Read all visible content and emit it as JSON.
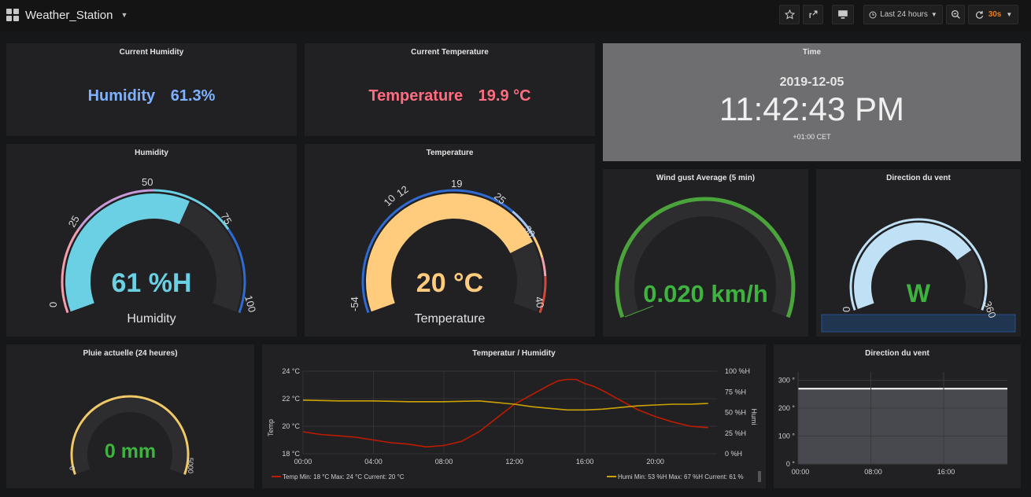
{
  "topbar": {
    "dashboard_title": "Weather_Station",
    "time_range": "Last 24 hours",
    "refresh": "30s"
  },
  "panels": {
    "current_humidity": {
      "title": "Current Humidity",
      "label": "Humidity",
      "value": "61.3%",
      "color": "#7eb2ff"
    },
    "current_temperature": {
      "title": "Current Temperature",
      "label": "Temperature",
      "value": "19.9 °C",
      "color": "#ff6d80"
    },
    "time": {
      "title": "Time",
      "date": "2019-12-05",
      "clock": "11:42:43 PM",
      "tz": "+01:00 CET"
    },
    "humidity_gauge": {
      "title": "Humidity",
      "value_text": "61 %H",
      "sub_label": "Humidity",
      "value": 61,
      "min": 0,
      "max": 100,
      "ticks": [
        "0",
        "25",
        "50",
        "75",
        "100"
      ],
      "fill_color": "#6bd0e3"
    },
    "temperature_gauge": {
      "title": "Temperature",
      "value_text": "20 °C",
      "sub_label": "Temperature",
      "value": 20,
      "min": -54,
      "max": 40,
      "ticks": [
        "-54",
        "10",
        "12",
        "19",
        "25",
        "30",
        "40"
      ],
      "fill_color": "#ffcb7d"
    },
    "wind_gust": {
      "title": "Wind gust Average (5 min)",
      "value_text": "0.020 km/h",
      "value": 0.02,
      "color": "#4ba43b"
    },
    "wind_direction_gauge": {
      "title": "Direction du vent",
      "value_text": "W",
      "tick": "360",
      "color": "#bfe0f5",
      "value_color": "#3fb33f"
    },
    "rain": {
      "title": "Pluie actuelle (24 heures)",
      "value_text": "0 mm",
      "value": 0,
      "tick_min": "0",
      "tick_max": "5000",
      "color": "#f0c868",
      "value_color": "#3fb33f"
    },
    "temp_humidity_chart": {
      "title": "Temperatur / Humidity",
      "legend_temp": "Temp  Min: 18 °C  Max: 24 °C  Current: 20 °C",
      "legend_humi": "Humi  Min: 53 %H  Max: 67 %H  Current: 61 %",
      "left_axis_title": "Temp",
      "right_axis_title": "Humi"
    },
    "wind_direction_chart": {
      "title": "Direction du vent"
    }
  },
  "chart_data": [
    {
      "type": "line",
      "title": "Temperatur / Humidity",
      "xlabel": "",
      "x_ticks": [
        "00:00",
        "04:00",
        "08:00",
        "12:00",
        "16:00",
        "20:00"
      ],
      "y_left_ticks": [
        "18 °C",
        "20 °C",
        "22 °C",
        "24 °C"
      ],
      "y_right_ticks": [
        "0 %H",
        "25 %H",
        "50 %H",
        "75 %H",
        "100 %H"
      ],
      "ylim_left": [
        18,
        24
      ],
      "ylim_right": [
        0,
        100
      ],
      "series": [
        {
          "name": "Temp",
          "axis": "left",
          "color": "#bf1b00",
          "x": [
            0,
            1,
            2,
            3,
            4,
            5,
            6,
            7,
            8,
            9,
            10,
            11,
            12,
            13,
            14,
            14.5,
            15,
            15.5,
            16,
            16.5,
            17,
            18,
            19,
            20,
            21,
            22,
            23
          ],
          "y": [
            19.6,
            19.4,
            19.3,
            19.2,
            19.0,
            18.8,
            18.7,
            18.5,
            18.6,
            18.9,
            19.6,
            20.6,
            21.6,
            22.3,
            23.0,
            23.3,
            23.4,
            23.4,
            23.1,
            22.9,
            22.6,
            21.9,
            21.2,
            20.7,
            20.3,
            20.0,
            19.9
          ]
        },
        {
          "name": "Humi",
          "axis": "right",
          "color": "#cca300",
          "x": [
            0,
            2,
            4,
            6,
            8,
            10,
            12,
            13,
            14,
            15,
            16,
            17,
            18,
            19,
            20,
            21,
            22,
            23
          ],
          "y": [
            65,
            64,
            64,
            63,
            63,
            64,
            60,
            57,
            55,
            53,
            53,
            54,
            56,
            58,
            59,
            60,
            60,
            61
          ]
        }
      ]
    },
    {
      "type": "area",
      "title": "Direction du vent",
      "x_ticks": [
        "00:00",
        "08:00",
        "16:00"
      ],
      "y_ticks": [
        "0 °",
        "100 °",
        "200 °",
        "300 °"
      ],
      "ylim": [
        0,
        330
      ],
      "series": [
        {
          "name": "",
          "color": "#ffffff",
          "x": [
            0,
            23
          ],
          "y": [
            270,
            270
          ]
        }
      ]
    }
  ]
}
